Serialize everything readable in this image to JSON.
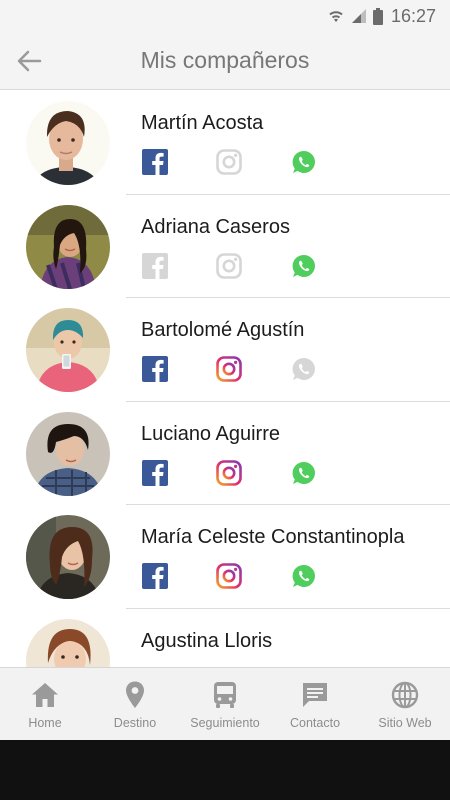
{
  "status_bar": {
    "time": "16:27"
  },
  "header": {
    "title": "Mis compañeros"
  },
  "classmates": [
    {
      "name": "Martín Acosta",
      "facebook": true,
      "instagram": false,
      "whatsapp": true
    },
    {
      "name": "Adriana Caseros",
      "facebook": false,
      "instagram": false,
      "whatsapp": true
    },
    {
      "name": "Bartolomé Agustín",
      "facebook": true,
      "instagram": true,
      "whatsapp": false
    },
    {
      "name": "Luciano Aguirre",
      "facebook": true,
      "instagram": true,
      "whatsapp": true
    },
    {
      "name": "María Celeste Constantinopla",
      "facebook": true,
      "instagram": true,
      "whatsapp": true
    },
    {
      "name": "Agustina Lloris",
      "facebook": false,
      "instagram": false,
      "whatsapp": false
    }
  ],
  "bottom_nav": [
    {
      "label": "Home",
      "icon": "home-icon"
    },
    {
      "label": "Destino",
      "icon": "location-pin-icon"
    },
    {
      "label": "Seguimiento",
      "icon": "bus-icon"
    },
    {
      "label": "Contacto",
      "icon": "chat-icon"
    },
    {
      "label": "Sitio Web",
      "icon": "globe-icon"
    }
  ],
  "colors": {
    "facebook": "#3b5998",
    "whatsapp": "#4fce5d",
    "disabled": "#d6d6d6",
    "nav_icon": "#9a9a9a"
  }
}
